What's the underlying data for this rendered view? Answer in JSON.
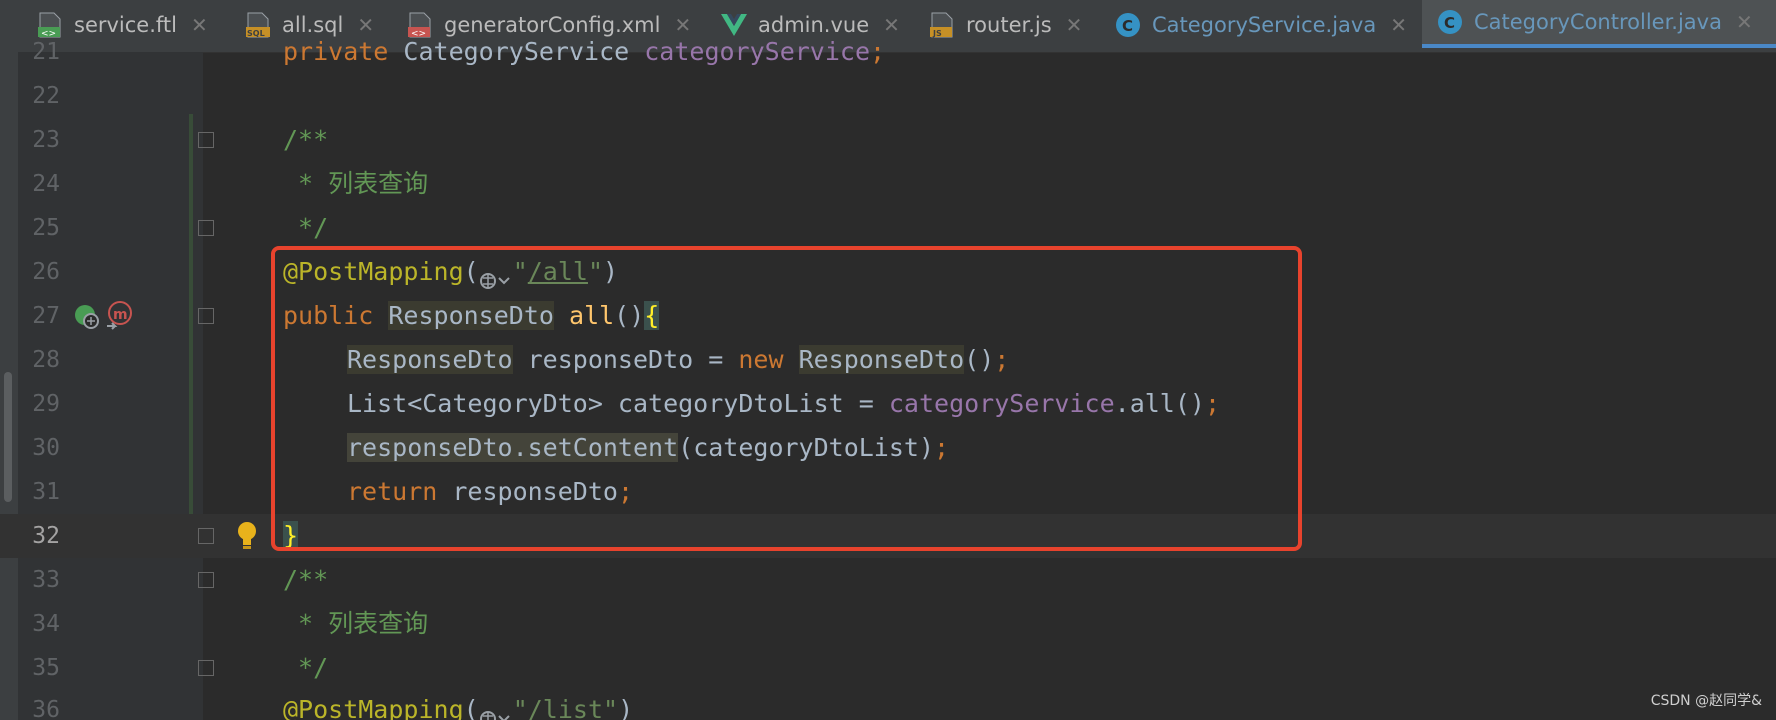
{
  "tabs": [
    {
      "label": "service.ftl",
      "icon": "ftl-file-icon"
    },
    {
      "label": "all.sql",
      "icon": "sql-file-icon"
    },
    {
      "label": "generatorConfig.xml",
      "icon": "xml-file-icon"
    },
    {
      "label": "admin.vue",
      "icon": "vue-file-icon"
    },
    {
      "label": "router.js",
      "icon": "js-file-icon"
    },
    {
      "label": "CategoryService.java",
      "icon": "java-class-icon"
    },
    {
      "label": "CategoryController.java",
      "icon": "java-class-icon",
      "active": true
    }
  ],
  "close_glyph": "✕",
  "line_numbers": [
    "21",
    "22",
    "23",
    "24",
    "25",
    "26",
    "27",
    "28",
    "29",
    "30",
    "31",
    "32",
    "33",
    "34",
    "35",
    "36"
  ],
  "code": {
    "l21_kw": "private",
    "l21_type": " CategoryService ",
    "l21_field": "categoryService",
    "l21_semi": ";",
    "l23": "/**",
    "l24": " * 列表查询",
    "l25": " */",
    "l26_ann": "@PostMapping",
    "l26_open": "(",
    "l26_q1": "\"",
    "l26_path": "/all",
    "l26_q2": "\"",
    "l26_close": ")",
    "l27_kw": "public",
    "l27_type": "ResponseDto",
    "l27_fn": "all",
    "l27_parens": "()",
    "l27_brace": "{",
    "l28_type": "ResponseDto",
    "l28_var": " responseDto = ",
    "l28_new": "new",
    "l28_type2": "ResponseDto",
    "l28_end": "()",
    "l28_semi": ";",
    "l29_a": "List<CategoryDto> categoryDtoList = ",
    "l29_field": "categoryService",
    "l29_b": ".all()",
    "l29_semi": ";",
    "l30_call": "responseDto.setContent",
    "l30_args": "(categoryDtoList)",
    "l30_semi": ";",
    "l31_kw": "return",
    "l31_var": " responseDto",
    "l31_semi": ";",
    "l32": "}",
    "l33": "/**",
    "l34": " * 列表查询",
    "l35": " */",
    "l36_ann": "@PostMapping",
    "l36_open": "(",
    "l36_q1": "\"",
    "l36_path": "/list",
    "l36_q2": "\"",
    "l36_close": ")"
  },
  "watermark": "CSDN @赵同学&",
  "colors": {
    "background": "#2b2b2b",
    "keyword": "#cc7832",
    "annotation": "#bbb529",
    "string": "#6a8759",
    "comment": "#629755",
    "field": "#9876aa",
    "method": "#ffc66d",
    "highlight_box": "#e8432d",
    "active_tab_accent": "#4a88c7"
  }
}
